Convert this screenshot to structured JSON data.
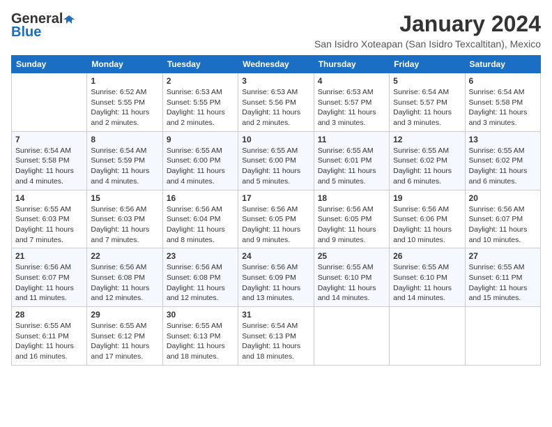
{
  "header": {
    "logo_general": "General",
    "logo_blue": "Blue",
    "month_title": "January 2024",
    "location": "San Isidro Xoteapan (San Isidro Texcaltitan), Mexico"
  },
  "days_of_week": [
    "Sunday",
    "Monday",
    "Tuesday",
    "Wednesday",
    "Thursday",
    "Friday",
    "Saturday"
  ],
  "weeks": [
    [
      {
        "day": "",
        "info": ""
      },
      {
        "day": "1",
        "info": "Sunrise: 6:52 AM\nSunset: 5:55 PM\nDaylight: 11 hours\nand 2 minutes."
      },
      {
        "day": "2",
        "info": "Sunrise: 6:53 AM\nSunset: 5:55 PM\nDaylight: 11 hours\nand 2 minutes."
      },
      {
        "day": "3",
        "info": "Sunrise: 6:53 AM\nSunset: 5:56 PM\nDaylight: 11 hours\nand 2 minutes."
      },
      {
        "day": "4",
        "info": "Sunrise: 6:53 AM\nSunset: 5:57 PM\nDaylight: 11 hours\nand 3 minutes."
      },
      {
        "day": "5",
        "info": "Sunrise: 6:54 AM\nSunset: 5:57 PM\nDaylight: 11 hours\nand 3 minutes."
      },
      {
        "day": "6",
        "info": "Sunrise: 6:54 AM\nSunset: 5:58 PM\nDaylight: 11 hours\nand 3 minutes."
      }
    ],
    [
      {
        "day": "7",
        "info": "Sunrise: 6:54 AM\nSunset: 5:58 PM\nDaylight: 11 hours\nand 4 minutes."
      },
      {
        "day": "8",
        "info": "Sunrise: 6:54 AM\nSunset: 5:59 PM\nDaylight: 11 hours\nand 4 minutes."
      },
      {
        "day": "9",
        "info": "Sunrise: 6:55 AM\nSunset: 6:00 PM\nDaylight: 11 hours\nand 4 minutes."
      },
      {
        "day": "10",
        "info": "Sunrise: 6:55 AM\nSunset: 6:00 PM\nDaylight: 11 hours\nand 5 minutes."
      },
      {
        "day": "11",
        "info": "Sunrise: 6:55 AM\nSunset: 6:01 PM\nDaylight: 11 hours\nand 5 minutes."
      },
      {
        "day": "12",
        "info": "Sunrise: 6:55 AM\nSunset: 6:02 PM\nDaylight: 11 hours\nand 6 minutes."
      },
      {
        "day": "13",
        "info": "Sunrise: 6:55 AM\nSunset: 6:02 PM\nDaylight: 11 hours\nand 6 minutes."
      }
    ],
    [
      {
        "day": "14",
        "info": "Sunrise: 6:55 AM\nSunset: 6:03 PM\nDaylight: 11 hours\nand 7 minutes."
      },
      {
        "day": "15",
        "info": "Sunrise: 6:56 AM\nSunset: 6:03 PM\nDaylight: 11 hours\nand 7 minutes."
      },
      {
        "day": "16",
        "info": "Sunrise: 6:56 AM\nSunset: 6:04 PM\nDaylight: 11 hours\nand 8 minutes."
      },
      {
        "day": "17",
        "info": "Sunrise: 6:56 AM\nSunset: 6:05 PM\nDaylight: 11 hours\nand 9 minutes."
      },
      {
        "day": "18",
        "info": "Sunrise: 6:56 AM\nSunset: 6:05 PM\nDaylight: 11 hours\nand 9 minutes."
      },
      {
        "day": "19",
        "info": "Sunrise: 6:56 AM\nSunset: 6:06 PM\nDaylight: 11 hours\nand 10 minutes."
      },
      {
        "day": "20",
        "info": "Sunrise: 6:56 AM\nSunset: 6:07 PM\nDaylight: 11 hours\nand 10 minutes."
      }
    ],
    [
      {
        "day": "21",
        "info": "Sunrise: 6:56 AM\nSunset: 6:07 PM\nDaylight: 11 hours\nand 11 minutes."
      },
      {
        "day": "22",
        "info": "Sunrise: 6:56 AM\nSunset: 6:08 PM\nDaylight: 11 hours\nand 12 minutes."
      },
      {
        "day": "23",
        "info": "Sunrise: 6:56 AM\nSunset: 6:08 PM\nDaylight: 11 hours\nand 12 minutes."
      },
      {
        "day": "24",
        "info": "Sunrise: 6:56 AM\nSunset: 6:09 PM\nDaylight: 11 hours\nand 13 minutes."
      },
      {
        "day": "25",
        "info": "Sunrise: 6:55 AM\nSunset: 6:10 PM\nDaylight: 11 hours\nand 14 minutes."
      },
      {
        "day": "26",
        "info": "Sunrise: 6:55 AM\nSunset: 6:10 PM\nDaylight: 11 hours\nand 14 minutes."
      },
      {
        "day": "27",
        "info": "Sunrise: 6:55 AM\nSunset: 6:11 PM\nDaylight: 11 hours\nand 15 minutes."
      }
    ],
    [
      {
        "day": "28",
        "info": "Sunrise: 6:55 AM\nSunset: 6:11 PM\nDaylight: 11 hours\nand 16 minutes."
      },
      {
        "day": "29",
        "info": "Sunrise: 6:55 AM\nSunset: 6:12 PM\nDaylight: 11 hours\nand 17 minutes."
      },
      {
        "day": "30",
        "info": "Sunrise: 6:55 AM\nSunset: 6:13 PM\nDaylight: 11 hours\nand 18 minutes."
      },
      {
        "day": "31",
        "info": "Sunrise: 6:54 AM\nSunset: 6:13 PM\nDaylight: 11 hours\nand 18 minutes."
      },
      {
        "day": "",
        "info": ""
      },
      {
        "day": "",
        "info": ""
      },
      {
        "day": "",
        "info": ""
      }
    ]
  ]
}
